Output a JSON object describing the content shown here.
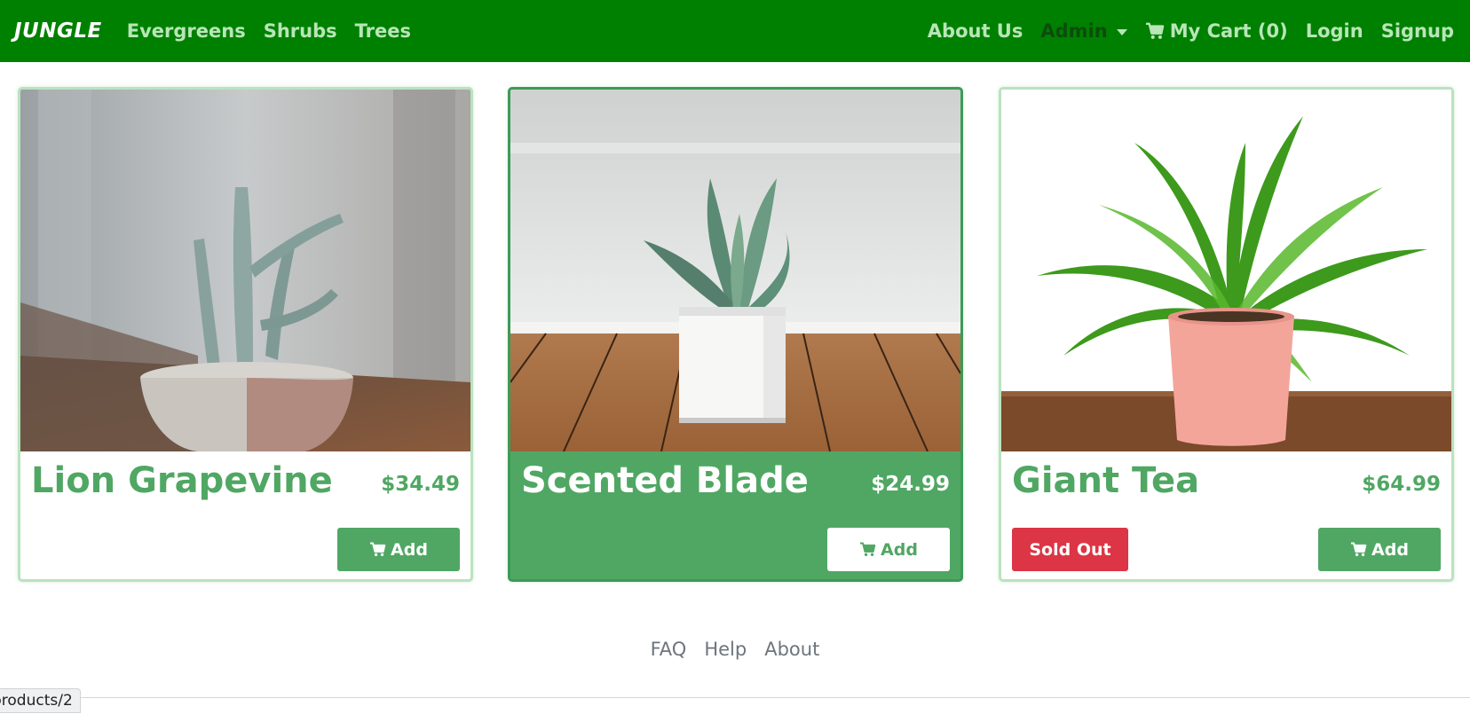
{
  "navbar": {
    "brand": "JUNGLE",
    "left_links": [
      {
        "label": "Evergreens"
      },
      {
        "label": "Shrubs"
      },
      {
        "label": "Trees"
      }
    ],
    "about": "About Us",
    "admin": "Admin",
    "cart": "My Cart (0)",
    "login": "Login",
    "signup": "Signup"
  },
  "products": [
    {
      "name": "Lion Grapevine",
      "price": "$34.49",
      "add_label": "Add",
      "sold_out": false
    },
    {
      "name": "Scented Blade",
      "price": "$24.99",
      "add_label": "Add",
      "sold_out": false
    },
    {
      "name": "Giant Tea",
      "price": "$64.99",
      "add_label": "Add",
      "sold_out": true,
      "sold_out_label": "Sold Out"
    }
  ],
  "footer": {
    "links": [
      "FAQ",
      "Help",
      "About"
    ]
  },
  "status_url": "products/2",
  "colors": {
    "navbar_bg": "#008000",
    "accent_green": "#50a763",
    "sold_out_red": "#dc3545"
  }
}
